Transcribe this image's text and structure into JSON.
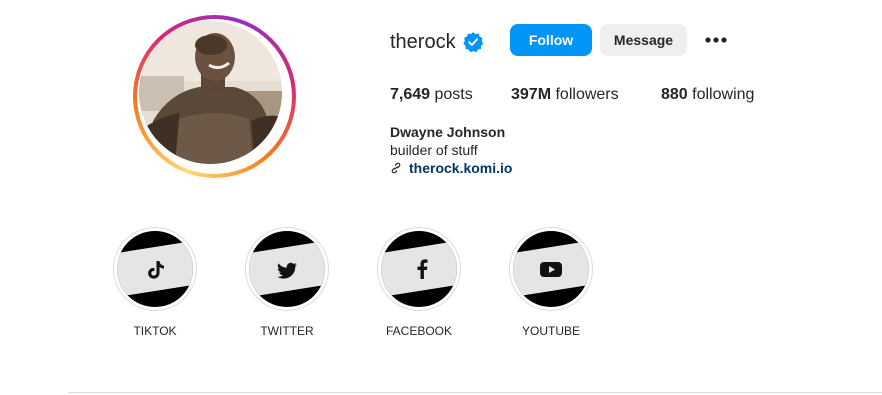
{
  "profile": {
    "username": "therock",
    "verified_icon": "verified-badge-icon",
    "avatar_icon": "profile-photo",
    "actions": {
      "follow_label": "Follow",
      "message_label": "Message",
      "more_icon": "more-options-icon"
    },
    "stats": {
      "posts_count": "7,649",
      "posts_label": "posts",
      "followers_count": "397M",
      "followers_label": "followers",
      "following_count": "880",
      "following_label": "following"
    },
    "full_name": "Dwayne Johnson",
    "bio": "builder of stuff",
    "link": {
      "icon": "link-icon",
      "text": "therock.komi.io"
    }
  },
  "highlights": [
    {
      "label": "TIKTOK",
      "icon": "tiktok-icon"
    },
    {
      "label": "TWITTER",
      "icon": "twitter-icon"
    },
    {
      "label": "FACEBOOK",
      "icon": "facebook-icon"
    },
    {
      "label": "YOUTUBE",
      "icon": "youtube-icon"
    }
  ],
  "colors": {
    "follow_button": "#0095f6",
    "message_button": "#efefef",
    "verified": "#0095f6",
    "link": "#00376b",
    "ring_gradient": [
      "#feda75",
      "#fa7e1e",
      "#d62976",
      "#962fbf"
    ]
  }
}
